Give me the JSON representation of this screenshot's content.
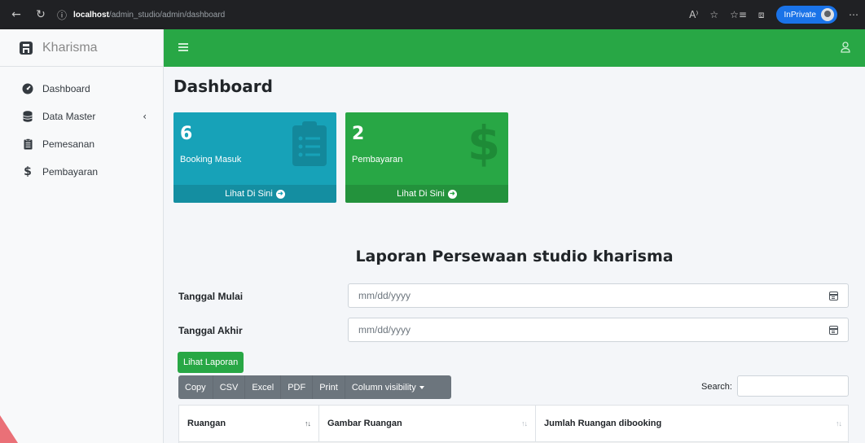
{
  "browser": {
    "url_host": "localhost",
    "url_path": "/admin_studio/admin/dashboard",
    "inprivate_label": "InPrivate"
  },
  "sidebar": {
    "brand": "Kharisma",
    "items": [
      {
        "label": "Dashboard",
        "icon": "tachometer-icon"
      },
      {
        "label": "Data Master",
        "icon": "database-icon"
      },
      {
        "label": "Pemesanan",
        "icon": "clipboard-icon"
      },
      {
        "label": "Pembayaran",
        "icon": "dollar-icon"
      }
    ]
  },
  "colors": {
    "topbar": "#28a745",
    "info": "#17a2b8",
    "success": "#28a745",
    "dt_buttons": "#6c757d"
  },
  "page": {
    "title": "Dashboard"
  },
  "cards": [
    {
      "number": "6",
      "label": "Booking Masuk",
      "footer": "Lihat Di Sini",
      "icon": "clipboard-list-icon"
    },
    {
      "number": "2",
      "label": "Pembayaran",
      "footer": "Lihat Di Sini",
      "icon": "dollar-icon"
    }
  ],
  "report": {
    "title": "Laporan Persewaan studio kharisma",
    "start_label": "Tanggal Mulai",
    "end_label": "Tanggal Akhir",
    "date_placeholder": "mm/dd/yyyy",
    "view_button": "Lihat Laporan"
  },
  "table_tools": {
    "buttons": [
      "Copy",
      "CSV",
      "Excel",
      "PDF",
      "Print",
      "Column visibility"
    ],
    "search_label": "Search:"
  },
  "table": {
    "headers": [
      "Ruangan",
      "Gambar Ruangan",
      "Jumlah Ruangan dibooking"
    ]
  }
}
